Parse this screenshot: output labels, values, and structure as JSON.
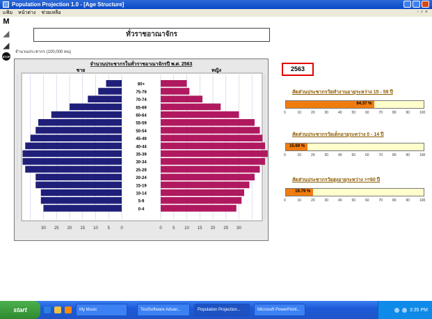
{
  "window": {
    "title": "Population Projection 1.0 - [Age Structure]",
    "menu": [
      "แฟ้ม",
      "หน้าต่าง",
      "ช่วยเหลือ"
    ],
    "menu_controls": "- ♂ ×"
  },
  "toolbar": [
    "M",
    "◢",
    "◢",
    "STOP"
  ],
  "region": "ทั่วราชอาณาจักร",
  "unit_note": "จำนวนประชากร (100,000 คน)",
  "pyramid": {
    "title": "จำนวนประชากรในทั่วราชอาณาจักรปี พ.ศ. 2563",
    "male_label": "ชาย",
    "female_label": "หญิง",
    "age_groups": [
      "80+",
      "75-79",
      "70-74",
      "65-69",
      "60-64",
      "55-59",
      "50-54",
      "45-49",
      "40-44",
      "35-39",
      "30-34",
      "25-29",
      "20-24",
      "15-19",
      "10-14",
      "5-9",
      "0-4"
    ],
    "male": [
      6,
      9,
      13,
      20,
      27,
      32,
      33,
      35,
      37,
      38,
      38,
      37,
      33,
      33,
      31,
      31,
      30
    ],
    "female": [
      10,
      11,
      16,
      23,
      30,
      36,
      38,
      39,
      40,
      41,
      40,
      38,
      36,
      34,
      32,
      31,
      29
    ],
    "x_ticks": [
      "30",
      "25",
      "20",
      "15",
      "10",
      "5",
      "0",
      "0",
      "5",
      "10",
      "15",
      "20",
      "25",
      "30"
    ],
    "colors": {
      "male": "#1f1f7a",
      "female": "#b0195f"
    }
  },
  "year": "2563",
  "ratios": [
    {
      "title": "สัดส่วนประชากรวัยทำงานอายุระหว่าง 15 - 59 ปี",
      "value": 64.37,
      "label": "64.37 %"
    },
    {
      "title": "สัดส่วนประชากรวัยเด็กอายุระหว่าง 0 - 14 ปี",
      "value": 15.69,
      "label": "15.69 %"
    },
    {
      "title": "สัดส่วนประชากรวัยสูงอายุระหว่าง >=60 ปี",
      "value": 19.79,
      "label": "19.79 %"
    }
  ],
  "ratio_axis": [
    "0",
    "10",
    "20",
    "30",
    "40",
    "50",
    "60",
    "70",
    "80",
    "90",
    "100"
  ],
  "taskbar": {
    "start": "start",
    "items": [
      "My Music",
      "TestSoftware Advan...",
      "Population Projection...",
      "Microsoft PowerPoint..."
    ],
    "clock": "3:35 PM"
  }
}
